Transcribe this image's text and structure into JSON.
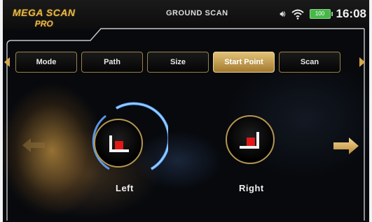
{
  "header": {
    "logo_line1": "MEGA SCAN",
    "logo_line2": "PRO",
    "title": "GROUND SCAN",
    "volume_icon": "speaker-volume-icon",
    "wifi_icon": "wifi-icon",
    "battery_level": "100",
    "time": "16:08"
  },
  "tabs": [
    {
      "label": "Mode",
      "active": false
    },
    {
      "label": "Path",
      "active": false
    },
    {
      "label": "Size",
      "active": false
    },
    {
      "label": "Start Point",
      "active": true
    },
    {
      "label": "Scan",
      "active": false
    }
  ],
  "start_point": {
    "options": [
      {
        "label": "Left",
        "selected": true
      },
      {
        "label": "Right",
        "selected": false
      }
    ]
  },
  "colors": {
    "accent_gold": "#d7a94a",
    "selection_blue": "#5fa8ff",
    "marker_red": "#e01818",
    "battery_green": "#47b848"
  }
}
